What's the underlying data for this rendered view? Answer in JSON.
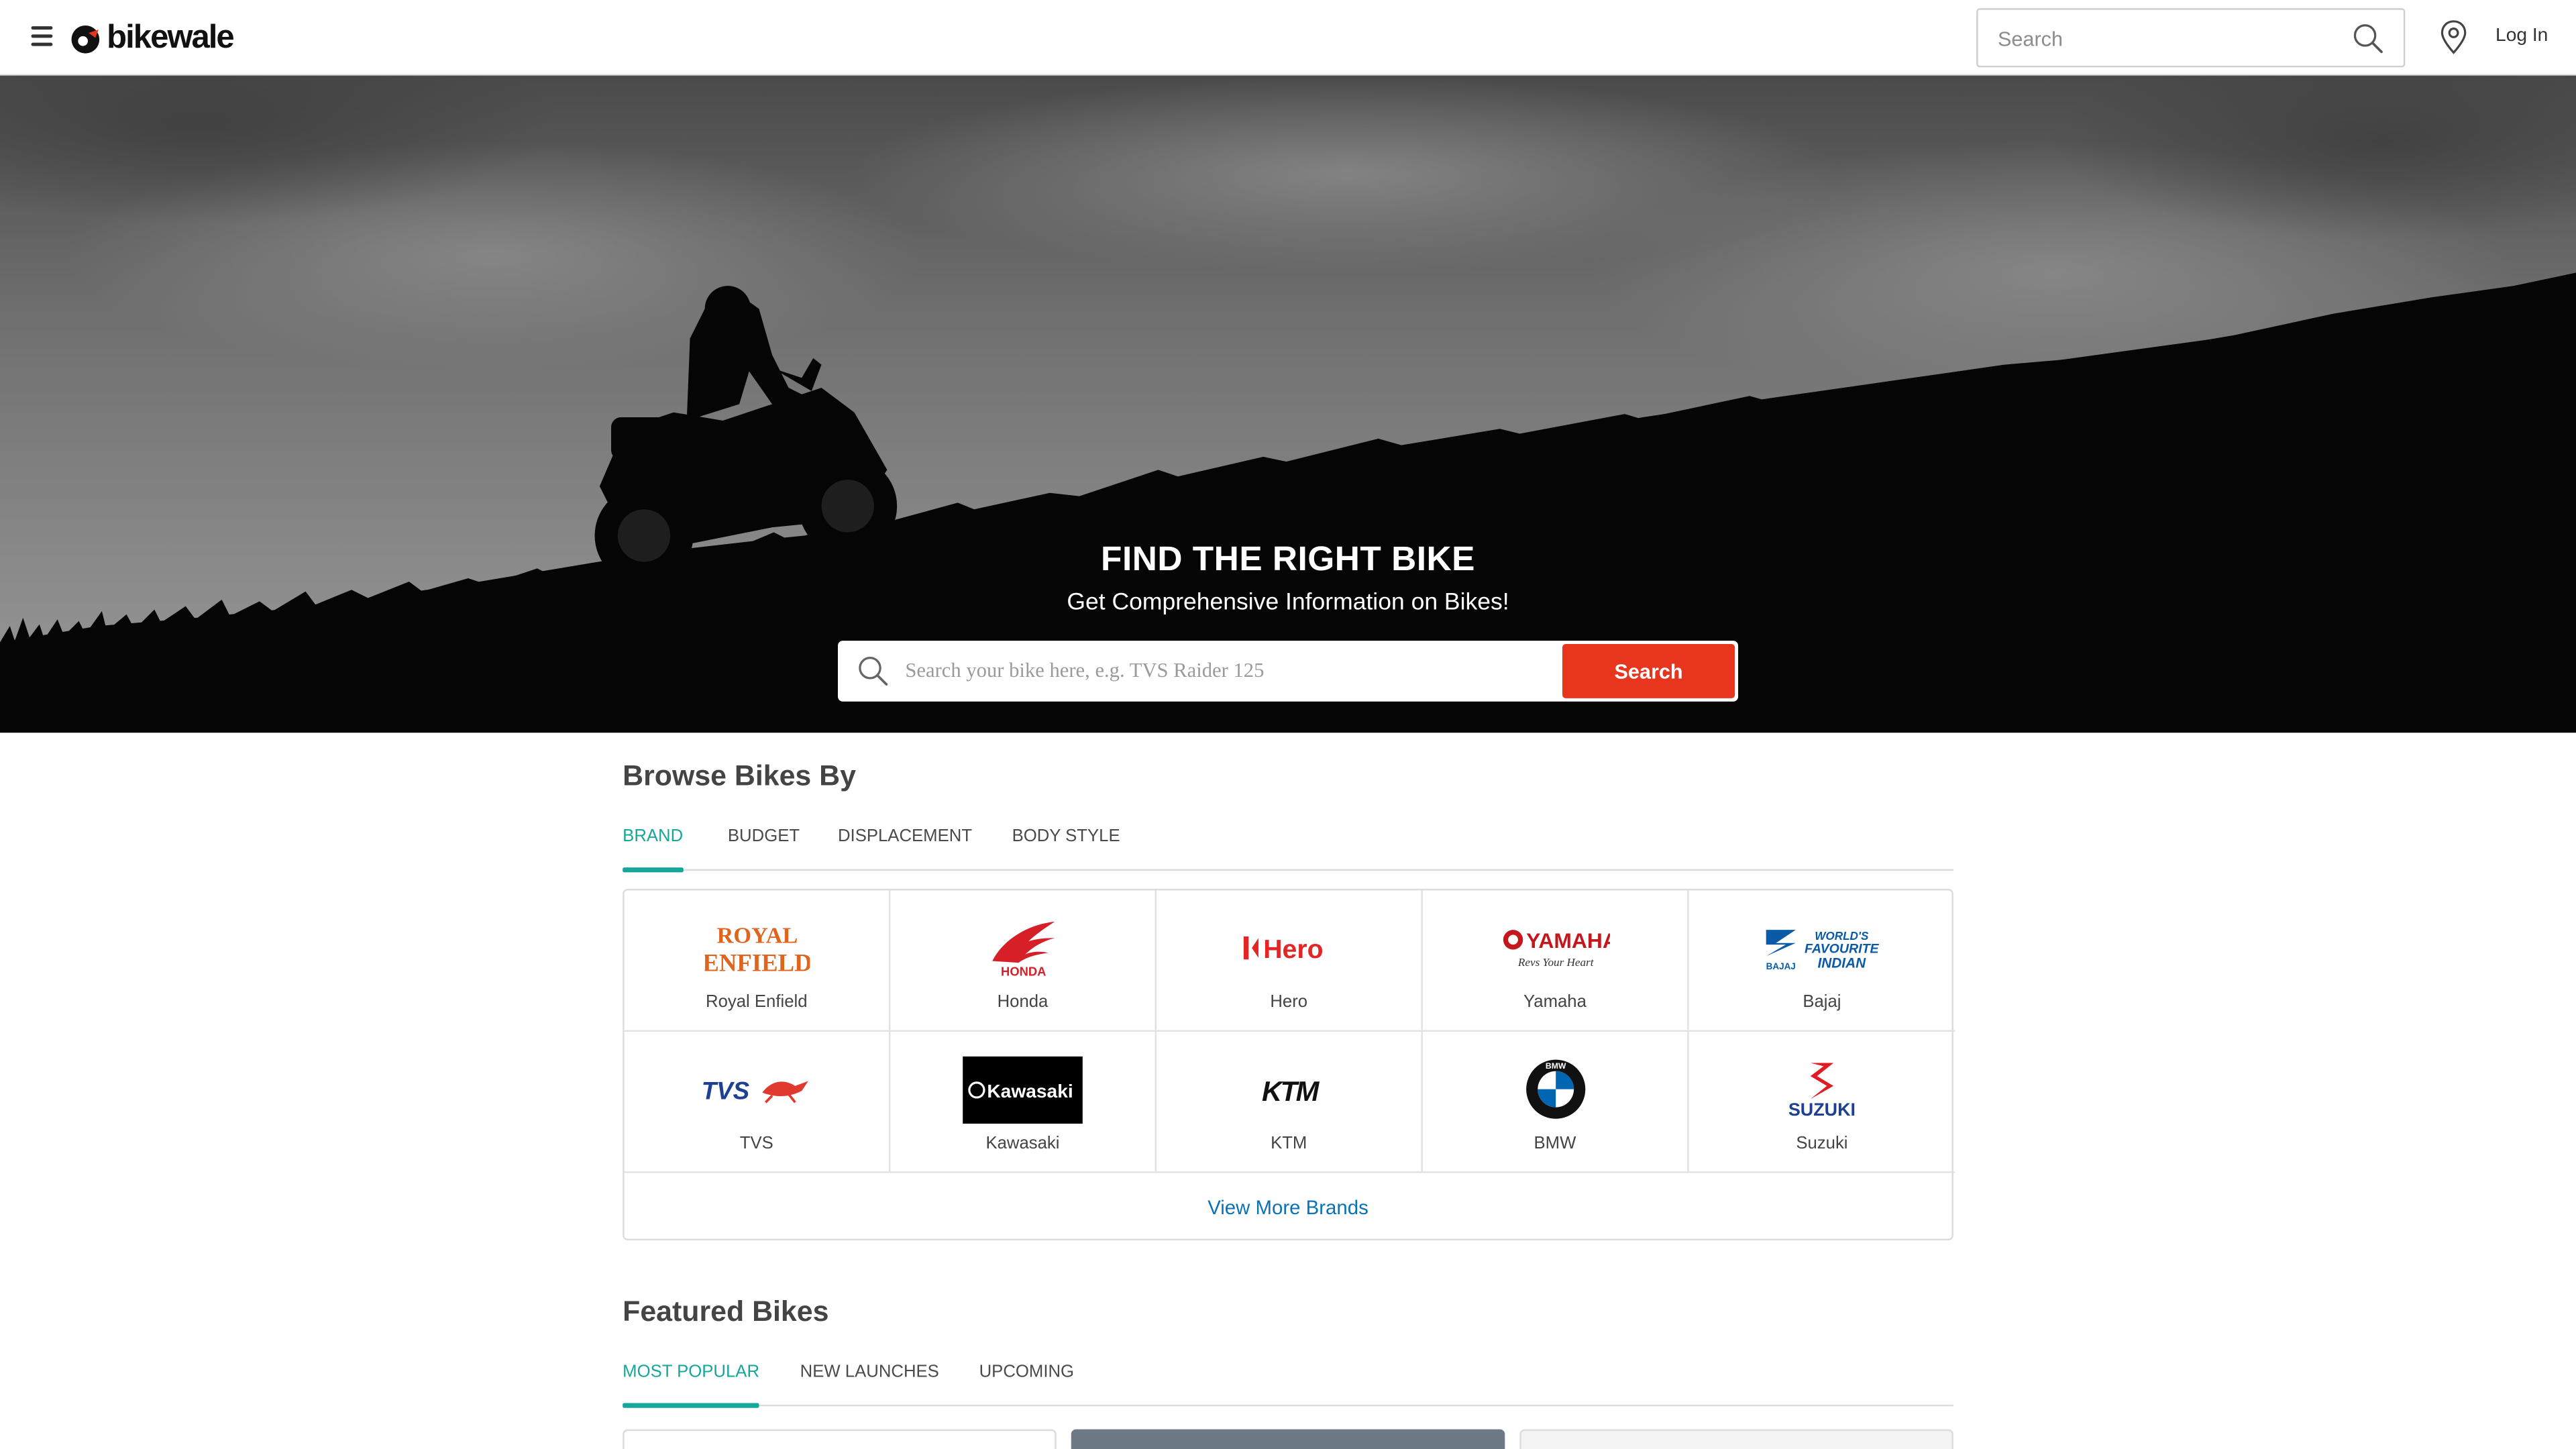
{
  "header": {
    "logo_text": "bikewale",
    "search_placeholder": "Search",
    "login_label": "Log In"
  },
  "hero": {
    "title": "FIND THE RIGHT BIKE",
    "subtitle": "Get Comprehensive Information on Bikes!",
    "search_placeholder": "Search your bike here, e.g. TVS Raider 125",
    "search_button": "Search"
  },
  "browse": {
    "title": "Browse Bikes By",
    "tabs": [
      {
        "label": "BRAND",
        "active": true
      },
      {
        "label": "BUDGET",
        "active": false
      },
      {
        "label": "DISPLACEMENT",
        "active": false
      },
      {
        "label": "BODY STYLE",
        "active": false
      }
    ],
    "brands": [
      {
        "label": "Royal Enfield",
        "logo_text": "ROYAL ENFIELD",
        "color": "#e0641e"
      },
      {
        "label": "Honda",
        "logo_text": "HONDA",
        "color": "#d61f26"
      },
      {
        "label": "Hero",
        "logo_text": "Hero",
        "color": "#e32526"
      },
      {
        "label": "Yamaha",
        "logo_text": "YAMAHA",
        "color": "#c4161c"
      },
      {
        "label": "Bajaj",
        "logo_text": "BAJAJ",
        "color": "#0a5aa8"
      },
      {
        "label": "TVS",
        "logo_text": "TVS",
        "color": "#1d3f94"
      },
      {
        "label": "Kawasaki",
        "logo_text": "Kawasaki",
        "color": "#000000"
      },
      {
        "label": "KTM",
        "logo_text": "KTM",
        "color": "#111111"
      },
      {
        "label": "BMW",
        "logo_text": "BMW",
        "color": "#0066b1"
      },
      {
        "label": "Suzuki",
        "logo_text": "SUZUKI",
        "color": "#e21b23"
      }
    ],
    "view_more": "View More Brands"
  },
  "featured": {
    "title": "Featured Bikes",
    "tabs": [
      {
        "label": "MOST POPULAR",
        "active": true
      },
      {
        "label": "NEW LAUNCHES",
        "active": false
      },
      {
        "label": "UPCOMING",
        "active": false
      }
    ]
  },
  "colors": {
    "accent": "#16a79b",
    "cta": "#e8361e",
    "link": "#0b72b5"
  }
}
